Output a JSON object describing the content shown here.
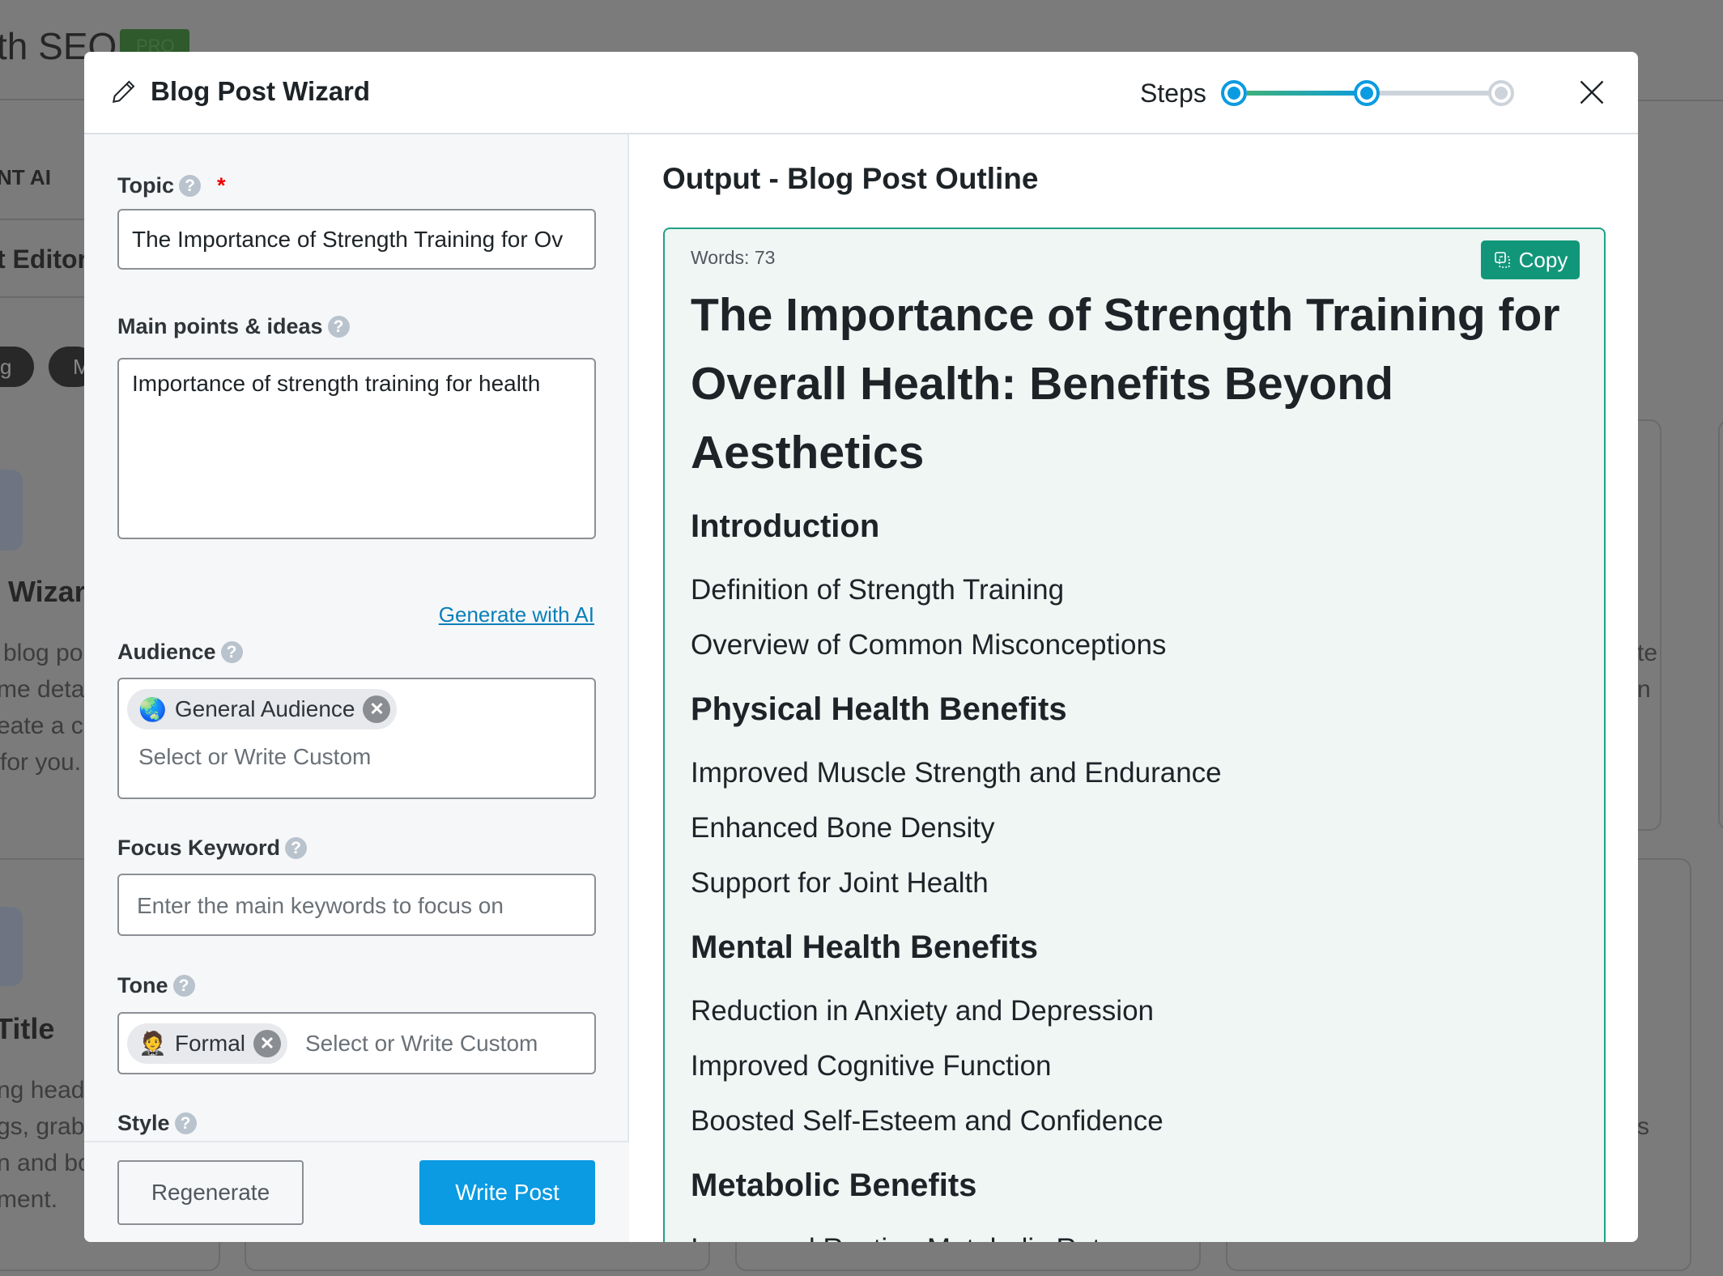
{
  "background": {
    "app_title": "th SEO",
    "badge": "PRO",
    "nav_items": [
      "NT AI",
      "t Editor"
    ],
    "pills": [
      "g",
      "M"
    ],
    "card1_title": "Wizar",
    "card1_lines": [
      "blog po",
      "me deta",
      "eate a co",
      "for you."
    ],
    "card2_title": "Title",
    "card2_lines": [
      "ng head",
      "gs, grab",
      "n and bo",
      "ment."
    ],
    "right_fragments": [
      "te",
      "n",
      "s"
    ]
  },
  "modal": {
    "title": "Blog Post Wizard",
    "title_icon": "pencil-icon",
    "steps_label": "Steps",
    "steps": [
      {
        "state": "complete"
      },
      {
        "state": "current"
      },
      {
        "state": "pending"
      }
    ],
    "colors": {
      "accent": "#0a9be2",
      "copy": "#12967a",
      "output_border": "#21a087"
    }
  },
  "form": {
    "topic": {
      "label": "Topic",
      "required_mark": "*",
      "value": "The Importance of Strength Training for Ov"
    },
    "main_points": {
      "label": "Main points & ideas",
      "value": "Importance of strength training for health"
    },
    "generate_link": "Generate with AI",
    "audience": {
      "label": "Audience",
      "chip": "General Audience",
      "chip_emoji": "🌏",
      "placeholder": "Select or Write Custom"
    },
    "focus_keyword": {
      "label": "Focus Keyword",
      "placeholder": "Enter the main keywords to focus on"
    },
    "tone": {
      "label": "Tone",
      "chip": "Formal",
      "chip_emoji": "🤵",
      "placeholder": "Select or Write Custom"
    },
    "style": {
      "label": "Style"
    },
    "help_glyph": "?",
    "remove_glyph": "✕"
  },
  "footer": {
    "regenerate": "Regenerate",
    "write_post": "Write Post"
  },
  "output": {
    "heading": "Output - Blog Post Outline",
    "words": "Words: 73",
    "copy": "Copy",
    "title": "The Importance of Strength Training for Overall Health: Benefits Beyond Aesthetics",
    "sections": [
      {
        "heading": "Introduction",
        "items": [
          "Definition of Strength Training",
          "Overview of Common Misconceptions"
        ]
      },
      {
        "heading": "Physical Health Benefits",
        "items": [
          "Improved Muscle Strength and Endurance",
          "Enhanced Bone Density",
          "Support for Joint Health"
        ]
      },
      {
        "heading": "Mental Health Benefits",
        "items": [
          "Reduction in Anxiety and Depression",
          "Improved Cognitive Function",
          "Boosted Self-Esteem and Confidence"
        ]
      },
      {
        "heading": "Metabolic Benefits",
        "items": [
          "Increased Resting Metabolic Rate"
        ]
      }
    ]
  }
}
